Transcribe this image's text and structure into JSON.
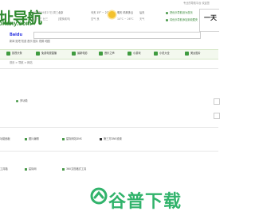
{
  "header": {
    "logo_main": "址导航",
    "logo_sub": "ohany.com",
    "date_line1": "2023年09月27日 周三",
    "date_line2": "八月十三 廿三",
    "city_line1": "北京",
    "city_line2": "[更换城市]",
    "today_line1": "今天  15° ~ 27°",
    "today_line2": "空气 良",
    "tomorrow_line1": "明天  晴转多云",
    "tomorrow_line2": "14°C ~ 26°C",
    "air_line1": "后天",
    "air_line2": "天气",
    "top_right": "专业的导航平台 欢迎您",
    "set_home": "把优乐导航设为首页",
    "add_fav": "将优乐导航添加到收藏夹",
    "right_word": "一天"
  },
  "search": {
    "engine": "Baidu",
    "engine_suffix": "百度",
    "links": "新闻  贴吧  知道  音乐  图片  视频  地图"
  },
  "categories": [
    "影视头条",
    "免费电视直播",
    "最新电影",
    "音乐之声",
    "小游戏",
    "小说大全",
    "美女图片"
  ],
  "breadcrumb": "首页 > 导航 > 网站",
  "section_title": "多功能",
  "rows": [
    {
      "label": "功能面板",
      "links": [
        "图片编辑",
        "星际网站DNS",
        "第三方DNS设置"
      ]
    },
    {
      "label": "工具箱",
      "links": [
        "星际网",
        "360文档格式工具"
      ]
    }
  ],
  "watermark": "谷普下载"
}
